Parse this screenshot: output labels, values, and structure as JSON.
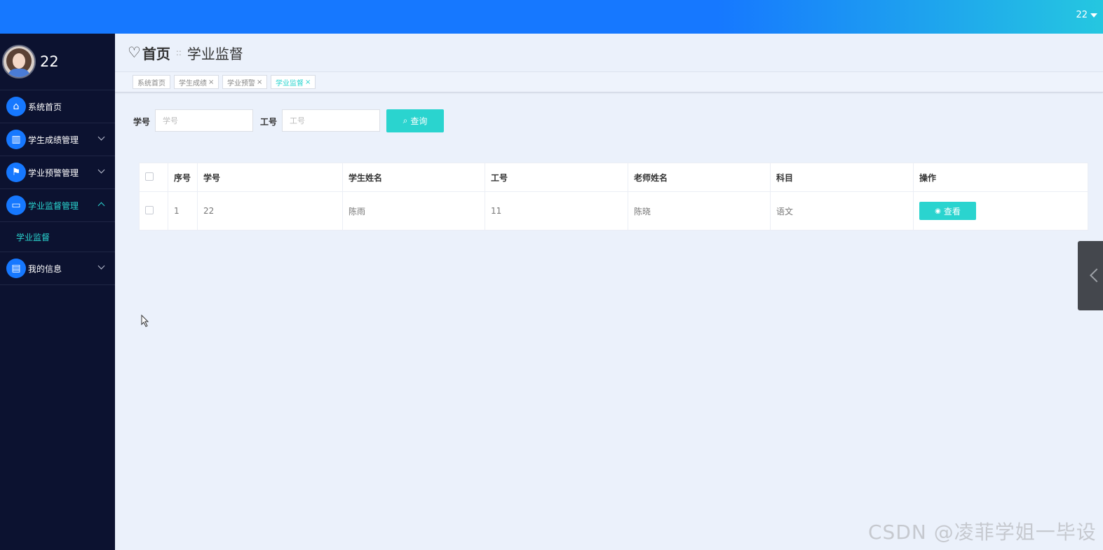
{
  "topbar": {
    "username": "22"
  },
  "sidebar": {
    "profile_name": "22",
    "items": [
      {
        "label": "系统首页",
        "icon": "home-icon",
        "glyph": "⌂",
        "active": false,
        "expandable": false
      },
      {
        "label": "学生成绩管理",
        "icon": "books-icon",
        "glyph": "▥",
        "active": false,
        "expandable": true
      },
      {
        "label": "学业预警管理",
        "icon": "flag-icon",
        "glyph": "⚑",
        "active": false,
        "expandable": true
      },
      {
        "label": "学业监督管理",
        "icon": "monitor-icon",
        "glyph": "▭",
        "active": true,
        "expandable": true,
        "expanded": true
      },
      {
        "label": "我的信息",
        "icon": "card-icon",
        "glyph": "▤",
        "active": false,
        "expandable": true
      }
    ],
    "submenu": {
      "label": "学业监督"
    }
  },
  "header": {
    "home": "首页",
    "separator": "::",
    "current": "学业监督"
  },
  "tabs": [
    {
      "label": "系统首页",
      "closable": false,
      "active": false
    },
    {
      "label": "学生成绩",
      "closable": true,
      "active": false
    },
    {
      "label": "学业预警",
      "closable": true,
      "active": false
    },
    {
      "label": "学业监督",
      "closable": true,
      "active": true
    }
  ],
  "tab_close_glyph": "×",
  "search": {
    "student_id_label": "学号",
    "student_id_placeholder": "学号",
    "student_id_value": "",
    "teacher_id_label": "工号",
    "teacher_id_placeholder": "工号",
    "teacher_id_value": "",
    "button_label": "查询"
  },
  "table": {
    "columns": [
      "序号",
      "学号",
      "学生姓名",
      "工号",
      "老师姓名",
      "科目",
      "操作"
    ],
    "rows": [
      {
        "index": "1",
        "student_id": "22",
        "student_name": "陈雨",
        "teacher_id": "11",
        "teacher_name": "陈晓",
        "subject": "语文",
        "action": "查看"
      }
    ]
  },
  "watermark": "CSDN @凌菲学姐一毕设",
  "colors": {
    "primary": "#1678ff",
    "accent": "#2ad4cf",
    "sidebar_bg": "#0c1230",
    "page_bg": "#ebf1fb"
  }
}
